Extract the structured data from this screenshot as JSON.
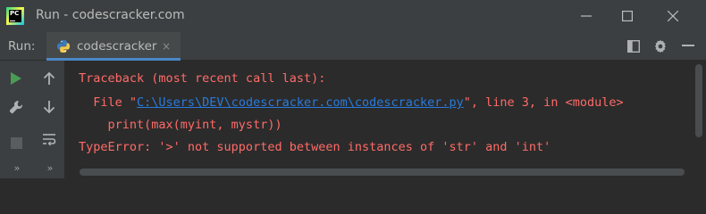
{
  "window": {
    "app_logo_text": "PC",
    "title": "Run - codescracker.com",
    "controls": [
      "minimize",
      "maximize",
      "close"
    ]
  },
  "run_panel": {
    "label": "Run:",
    "tab": {
      "label": "codescracker",
      "close": "×",
      "icon": "python-icon"
    },
    "header_icons": [
      "layout-icon",
      "gear-icon",
      "hide-icon"
    ]
  },
  "toolbar_left": [
    "run-icon",
    "wrench-icon",
    "stop-icon",
    "more-icon"
  ],
  "toolbar_right": [
    "arrow-up-icon",
    "arrow-down-icon",
    "soft-wrap-icon",
    "more-icon"
  ],
  "more_glyph": "»",
  "console": {
    "line1": "Traceback (most recent call last):",
    "line2_prefix": "  File \"",
    "line2_path": "C:\\Users\\DEV\\codescracker.com\\codescracker.py",
    "line2_suffix": "\", line 3, in <module>",
    "line3": "    print(max(myint, mystr))",
    "line4": "TypeError: '>' not supported between instances of 'str' and 'int'"
  },
  "colors": {
    "background": "#2b2b2b",
    "panel": "#3c3f41",
    "error_text": "#ff6b68",
    "link": "#287bde",
    "run_green": "#499c54",
    "tab_accent": "#4a88c7"
  }
}
